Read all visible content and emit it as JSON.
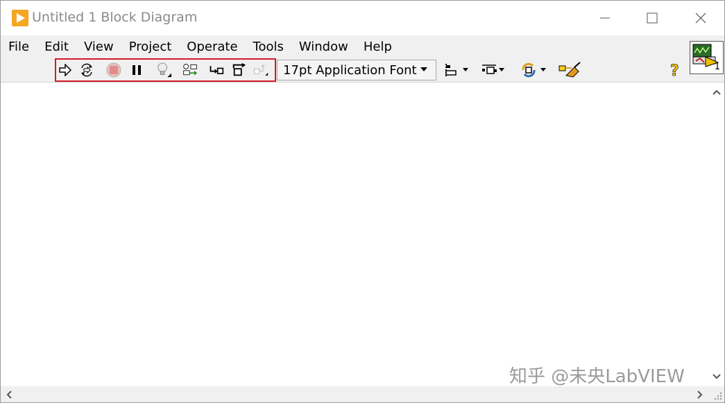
{
  "window": {
    "title": "Untitled 1 Block Diagram"
  },
  "menu": {
    "items": [
      "File",
      "Edit",
      "View",
      "Project",
      "Operate",
      "Tools",
      "Window",
      "Help"
    ]
  },
  "toolbar": {
    "font_select": "17pt Application Font",
    "icons": [
      "run-arrow-icon",
      "run-continuously-icon",
      "abort-execution-icon",
      "pause-icon",
      "highlight-execution-icon",
      "retain-wire-values-icon",
      "step-into-icon",
      "step-over-icon",
      "step-out-icon",
      "align-objects-icon",
      "distribute-objects-icon",
      "reorder-icon",
      "clean-up-diagram-icon",
      "context-help-icon"
    ]
  },
  "connector_pane": {
    "number": "1"
  },
  "watermark": "知乎 @未央LabVIEW",
  "colors": {
    "highlight_box": "#d11a2a",
    "menu_bg": "#f0f0f0",
    "app_icon": "#f5a623"
  }
}
